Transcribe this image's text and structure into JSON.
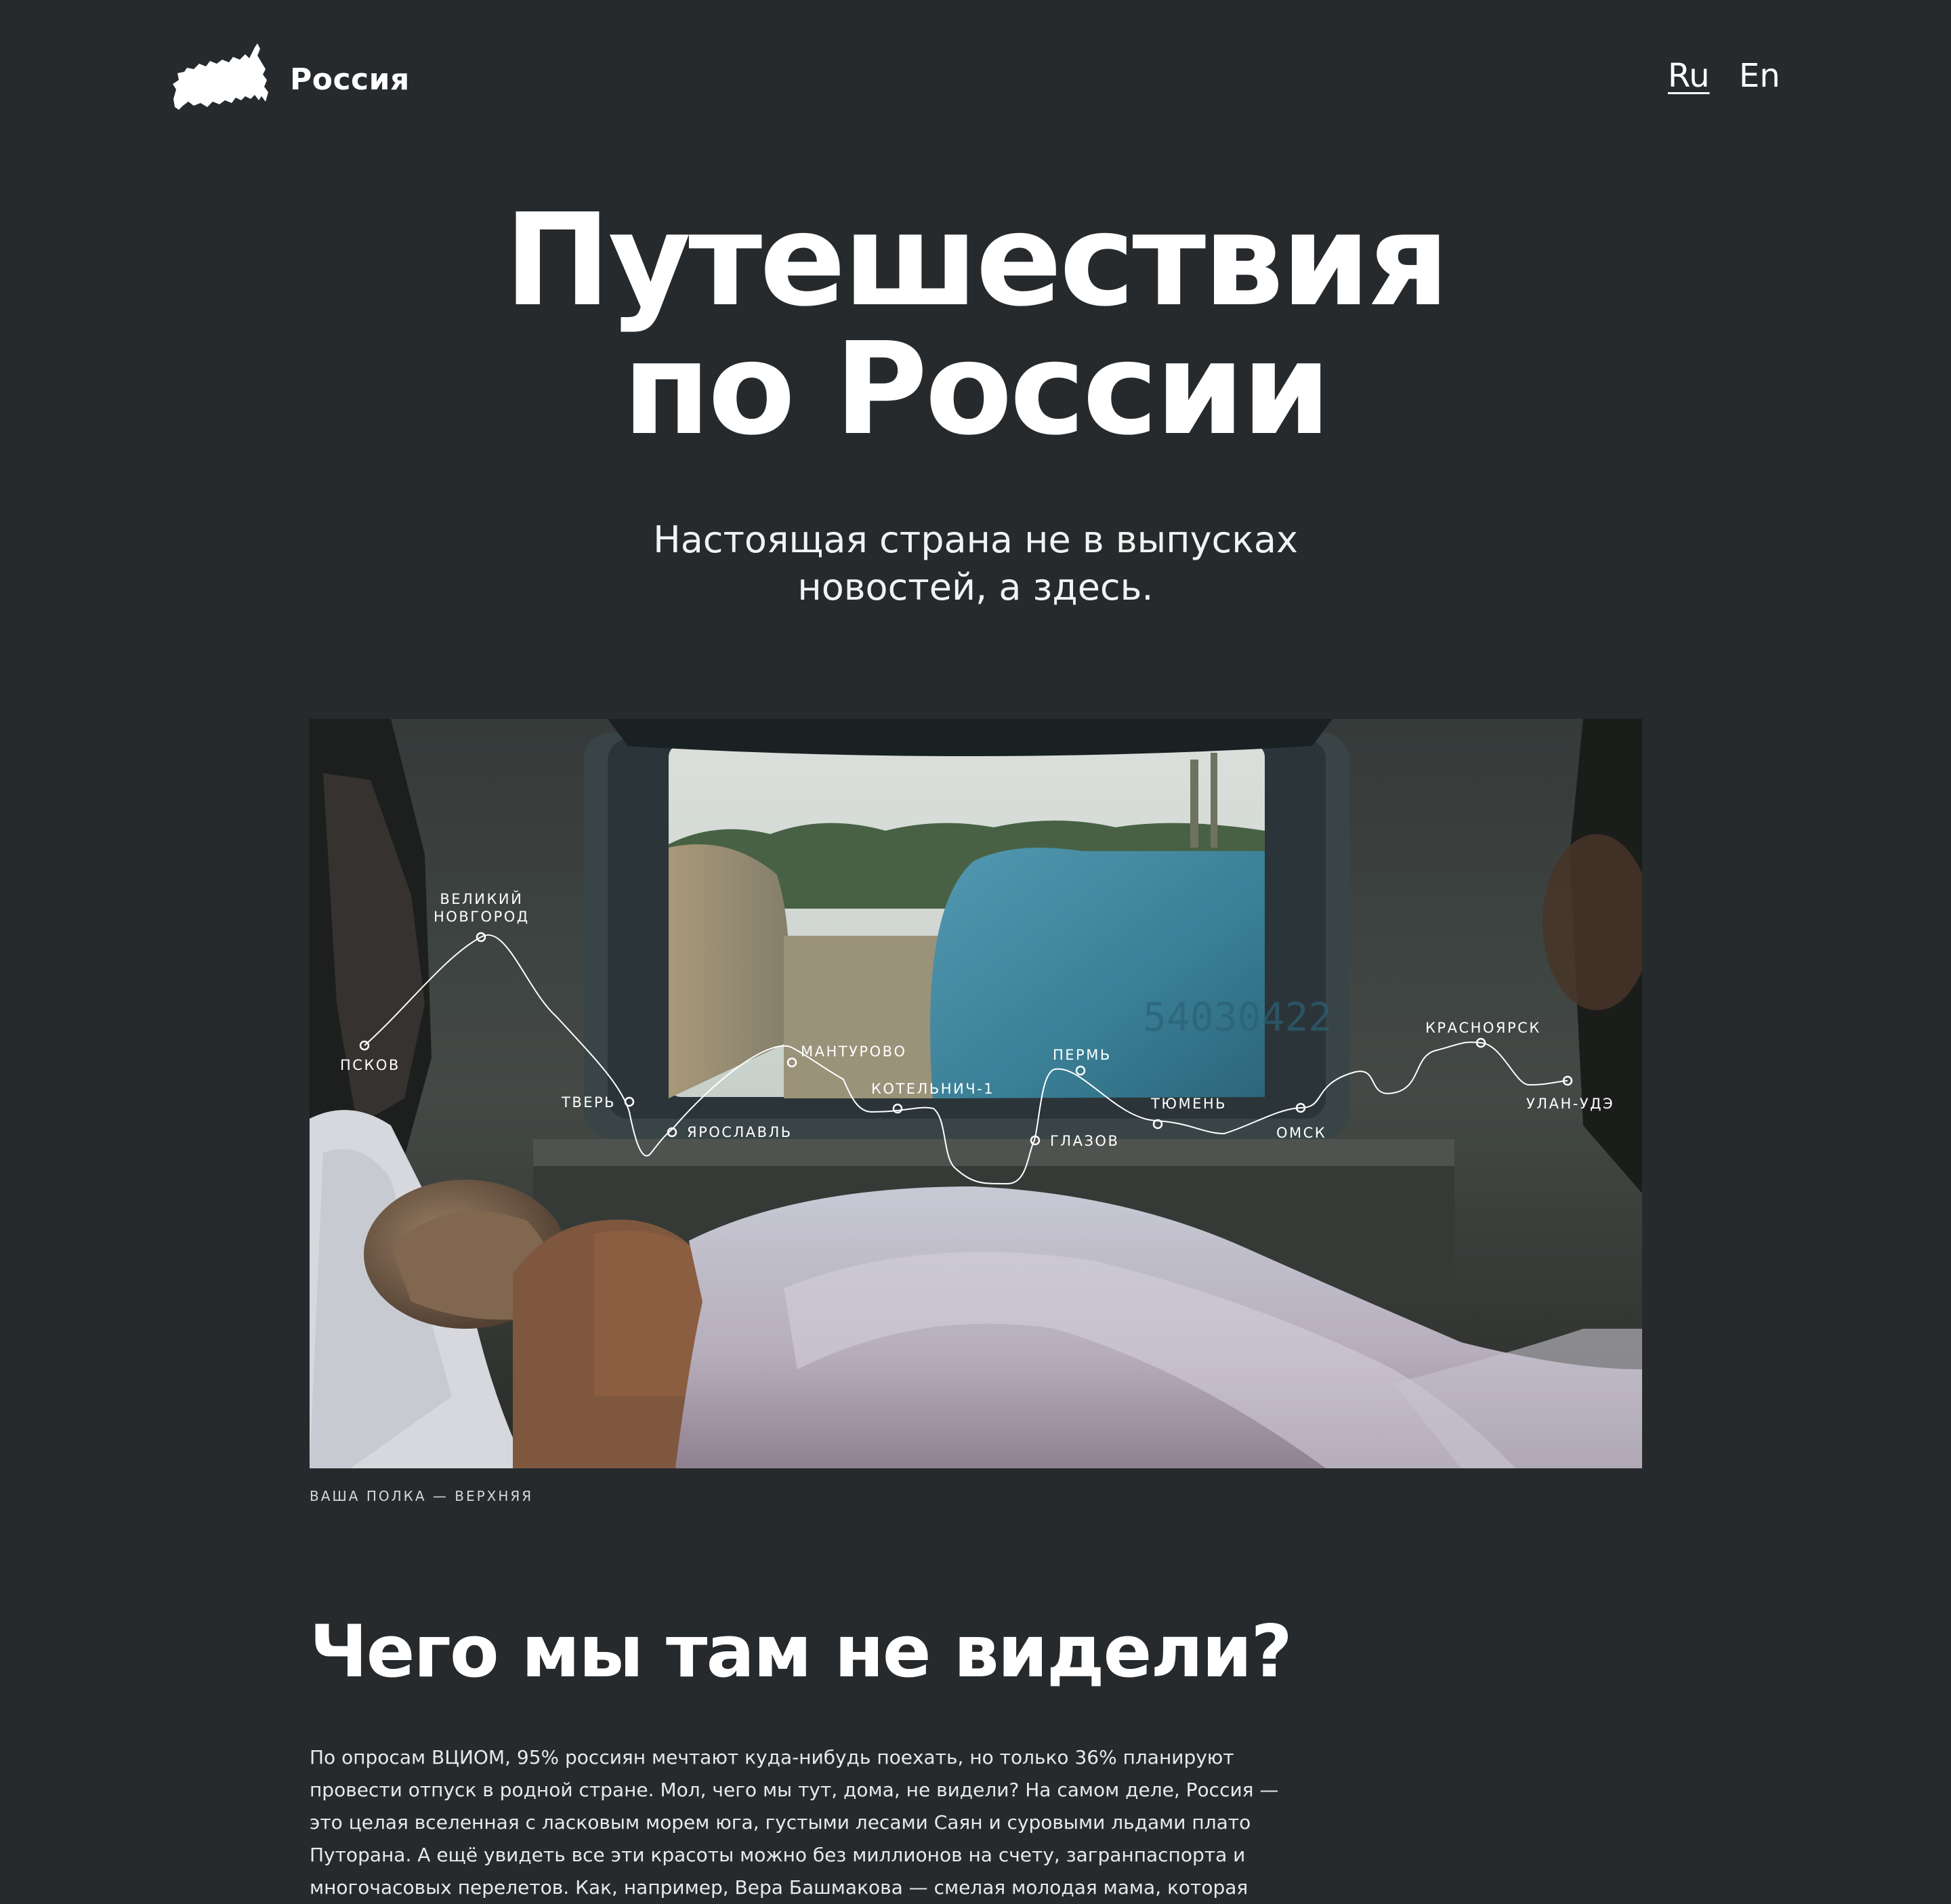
{
  "header": {
    "logo_text": "Россия",
    "lang_ru": "Ru",
    "lang_en": "En"
  },
  "hero": {
    "title_line1": "Путешествия",
    "title_line2": "по России",
    "subtitle_line1": "Настоящая страна не в выпусках",
    "subtitle_line2": "новостей, а здесь."
  },
  "photo": {
    "caption": "ВАША ПОЛКА — ВЕРХНЯЯ",
    "cities": {
      "pskov": "ПСКОВ",
      "novgorod_1": "ВЕЛИКИЙ",
      "novgorod_2": "НОВГОРОД",
      "tver": "ТВЕРЬ",
      "yaroslavl": "ЯРОСЛАВЛЬ",
      "manturovo": "МАНТУРОВО",
      "kotelnich": "КОТЕЛЬНИЧ-1",
      "glazov": "ГЛАЗОВ",
      "perm": "ПЕРМЬ",
      "tyumen": "ТЮМЕНЬ",
      "omsk": "ОМСК",
      "krasnoyarsk": "КРАСНОЯРСК",
      "ulan_ude": "УЛАН-УДЭ"
    }
  },
  "section": {
    "title": "Чего мы там не видели?",
    "paragraph_lines": [
      "По опросам ВЦИОМ, 95% россиян мечтают куда-нибудь поехать, но только 36% планируют",
      "провести отпуск в родной стране. Мол, чего мы тут, дома, не видели? На самом деле, Россия —",
      "это целая вселенная с ласковым морем юга, густыми лесами Саян и суровыми льдами плато",
      "Путорана. А ещё увидеть все эти красоты можно без миллионов на счету, загранпаспорта и",
      "многочасовых перелетов. Как, например, Вера Башмакова — смелая молодая мама, которая"
    ]
  },
  "colors": {
    "background": "#272a2d",
    "text": "#ffffff"
  }
}
